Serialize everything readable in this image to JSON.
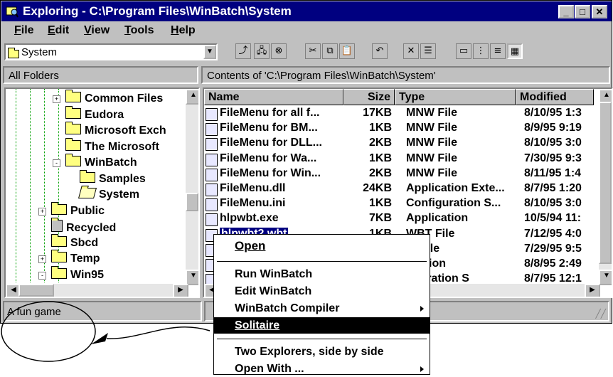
{
  "window": {
    "title": "Exploring - C:\\Program Files\\WinBatch\\System",
    "min_label": "_",
    "max_label": "□",
    "close_label": "✕"
  },
  "menu": [
    "File",
    "Edit",
    "View",
    "Tools",
    "Help"
  ],
  "toolbar": {
    "location_value": "System",
    "tool_icons": [
      "up-folder-icon",
      "map-drive-icon",
      "disconnect-drive-icon",
      "cut-icon",
      "copy-icon",
      "paste-icon",
      "undo-icon",
      "delete-icon",
      "properties-icon",
      "large-icons-icon",
      "small-icons-icon",
      "list-view-icon",
      "details-view-icon"
    ]
  },
  "left_pane": {
    "header": "All Folders",
    "folders": [
      {
        "label": "Common Files",
        "indent": 3,
        "expander": "+"
      },
      {
        "label": "Eudora",
        "indent": 3,
        "expander": ""
      },
      {
        "label": "Microsoft Exch",
        "indent": 3,
        "expander": ""
      },
      {
        "label": "The Microsoft",
        "indent": 3,
        "expander": ""
      },
      {
        "label": "WinBatch",
        "indent": 3,
        "expander": "-"
      },
      {
        "label": "Samples",
        "indent": 4,
        "expander": ""
      },
      {
        "label": "System",
        "indent": 4,
        "expander": "",
        "open": true
      },
      {
        "label": "Public",
        "indent": 2,
        "expander": "+"
      },
      {
        "label": "Recycled",
        "indent": 2,
        "expander": "",
        "recycle": true
      },
      {
        "label": "Sbcd",
        "indent": 2,
        "expander": ""
      },
      {
        "label": "Temp",
        "indent": 2,
        "expander": "+"
      },
      {
        "label": "Win95",
        "indent": 2,
        "expander": "-"
      }
    ]
  },
  "right_pane": {
    "header": "Contents of 'C:\\Program Files\\WinBatch\\System'",
    "columns": [
      "Name",
      "Size",
      "Type",
      "Modified"
    ],
    "rows": [
      {
        "name": "FileMenu for all f...",
        "size": "17KB",
        "type": "MNW File",
        "modified": "8/10/95 1:3"
      },
      {
        "name": "FileMenu for BM...",
        "size": "1KB",
        "type": "MNW File",
        "modified": "8/9/95 9:19"
      },
      {
        "name": "FileMenu for DLL...",
        "size": "2KB",
        "type": "MNW File",
        "modified": "8/10/95 3:0"
      },
      {
        "name": "FileMenu for Wa...",
        "size": "1KB",
        "type": "MNW File",
        "modified": "7/30/95 9:3"
      },
      {
        "name": "FileMenu for Win...",
        "size": "2KB",
        "type": "MNW File",
        "modified": "8/11/95 1:4"
      },
      {
        "name": "FileMenu.dll",
        "size": "24KB",
        "type": "Application Exte...",
        "modified": "8/7/95 1:20"
      },
      {
        "name": "FileMenu.ini",
        "size": "1KB",
        "type": "Configuration S...",
        "modified": "8/10/95 3:0"
      },
      {
        "name": "hlpwbt.exe",
        "size": "7KB",
        "type": "Application",
        "modified": "10/5/94 11:"
      },
      {
        "name": "hlpwbt2.wbt",
        "size": "1KB",
        "type": "WBT File",
        "modified": "7/12/95 4:0",
        "selected": true
      },
      {
        "name": "",
        "size": "",
        "type": "W File",
        "modified": "7/29/95 9:5"
      },
      {
        "name": "",
        "size": "",
        "type": "lication",
        "modified": "8/8/95 2:49"
      },
      {
        "name": "",
        "size": "",
        "type": "figuration S",
        "modified": "8/7/95 12:1"
      }
    ]
  },
  "status": {
    "text": "A fun game"
  },
  "context_menu": {
    "items": [
      {
        "label": "Open",
        "default": true
      },
      {
        "sep": true
      },
      {
        "label": "Run WinBatch"
      },
      {
        "label": "Edit WinBatch"
      },
      {
        "label": "WinBatch Compiler",
        "submenu": true
      },
      {
        "label": "Solitaire",
        "highlighted": true
      },
      {
        "sep": true
      },
      {
        "label": "Two Explorers, side by side"
      },
      {
        "label": "Open With ...",
        "submenu": true
      }
    ]
  },
  "colors": {
    "title_bar": "#000080",
    "face": "#c0c0c0",
    "highlight": "#000000",
    "folder": "#ffff80"
  }
}
